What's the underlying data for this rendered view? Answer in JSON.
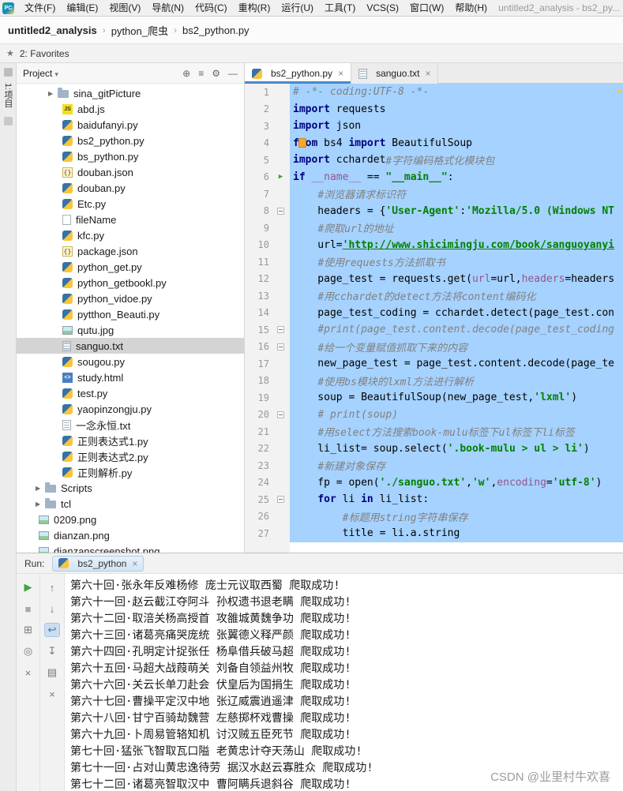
{
  "colors": {
    "selection": "#A6D2FF",
    "keyword": "#000080",
    "string": "#008000",
    "comment": "#808080",
    "param": "#94558D",
    "tab_accent": "#4A88C7",
    "run_green": "#3FA342"
  },
  "title_bar": {
    "logo": "PC",
    "menus": [
      "文件(F)",
      "编辑(E)",
      "视图(V)",
      "导航(N)",
      "代码(C)",
      "重构(R)",
      "运行(U)",
      "工具(T)",
      "VCS(S)",
      "窗口(W)",
      "帮助(H)"
    ],
    "window_title": "untitled2_analysis - bs2_py..."
  },
  "breadcrumb": [
    "untitled2_analysis",
    "python_爬虫",
    "bs2_python.py"
  ],
  "favorites": {
    "label": "2: Favorites"
  },
  "tool_strip": {
    "label": "1:项目"
  },
  "project": {
    "title": "Project",
    "header_icons": [
      {
        "name": "locate-icon",
        "glyph": "⊕"
      },
      {
        "name": "collapse-all-icon",
        "glyph": "≡"
      },
      {
        "name": "settings-icon",
        "glyph": "⚙"
      },
      {
        "name": "hide-panel-icon",
        "glyph": "—"
      }
    ],
    "items": [
      {
        "label": "sina_gitPicture",
        "icon": "folder",
        "indent": 40,
        "arrow": true
      },
      {
        "label": "abd.js",
        "icon": "js",
        "indent": 58
      },
      {
        "label": "baidufanyi.py",
        "icon": "python",
        "indent": 58
      },
      {
        "label": "bs2_python.py",
        "icon": "python",
        "indent": 58
      },
      {
        "label": "bs_python.py",
        "icon": "python",
        "indent": 58
      },
      {
        "label": "douban.json",
        "icon": "json",
        "indent": 58
      },
      {
        "label": "douban.py",
        "icon": "python",
        "indent": 58
      },
      {
        "label": "Etc.py",
        "icon": "python",
        "indent": 58
      },
      {
        "label": "fileName",
        "icon": "file",
        "indent": 58
      },
      {
        "label": "kfc.py",
        "icon": "python",
        "indent": 58
      },
      {
        "label": "package.json",
        "icon": "json",
        "indent": 58
      },
      {
        "label": "python_get.py",
        "icon": "python",
        "indent": 58
      },
      {
        "label": "python_getbookl.py",
        "icon": "python",
        "indent": 58
      },
      {
        "label": "python_vidoe.py",
        "icon": "python",
        "indent": 58
      },
      {
        "label": "pytthon_Beauti.py",
        "icon": "python",
        "indent": 58
      },
      {
        "label": "qutu.jpg",
        "icon": "image",
        "indent": 58
      },
      {
        "label": "sanguo.txt",
        "icon": "text",
        "indent": 58,
        "selected": true
      },
      {
        "label": "sougou.py",
        "icon": "python",
        "indent": 58
      },
      {
        "label": "study.html",
        "icon": "html",
        "indent": 58
      },
      {
        "label": "test.py",
        "icon": "python",
        "indent": 58
      },
      {
        "label": "yaopinzongju.py",
        "icon": "python",
        "indent": 58
      },
      {
        "label": "一念永恒.txt",
        "icon": "text",
        "indent": 58
      },
      {
        "label": "正则表达式1.py",
        "icon": "python",
        "indent": 58
      },
      {
        "label": "正则表达式2.py",
        "icon": "python",
        "indent": 58
      },
      {
        "label": "正则解析.py",
        "icon": "python",
        "indent": 58
      },
      {
        "label": "Scripts",
        "icon": "folder",
        "indent": 24,
        "arrow": true
      },
      {
        "label": "tcl",
        "icon": "folder",
        "indent": 24,
        "arrow": true
      },
      {
        "label": "0209.png",
        "icon": "image",
        "indent": 28
      },
      {
        "label": "dianzan.png",
        "icon": "image",
        "indent": 28
      },
      {
        "label": "dianzanscreenshot.png",
        "icon": "image",
        "indent": 28
      }
    ]
  },
  "editor": {
    "tabs": [
      {
        "label": "bs2_python.py",
        "icon": "python",
        "active": true
      },
      {
        "label": "sanguo.txt",
        "icon": "text",
        "active": false
      }
    ],
    "lines": [
      {
        "n": 1,
        "seg": [
          [
            "c",
            "# -*- coding:UTF-8 -*-"
          ]
        ]
      },
      {
        "n": 2,
        "seg": [
          [
            "k",
            "import"
          ],
          [
            "t",
            " requests"
          ]
        ]
      },
      {
        "n": 3,
        "seg": [
          [
            "k",
            "import"
          ],
          [
            "t",
            " json"
          ]
        ]
      },
      {
        "n": 4,
        "bulb": true,
        "seg": [
          [
            "k",
            "from"
          ],
          [
            "t",
            " bs4 "
          ],
          [
            "k",
            "import"
          ],
          [
            "t",
            " BeautifulSoup"
          ]
        ]
      },
      {
        "n": 5,
        "seg": [
          [
            "k",
            "import"
          ],
          [
            "t",
            " cchardet"
          ],
          [
            "c",
            "#字符编码格式化模块包"
          ]
        ]
      },
      {
        "n": 6,
        "mark": "run",
        "seg": [
          [
            "k",
            "if"
          ],
          [
            "t",
            " "
          ],
          [
            "d",
            "__name__"
          ],
          [
            "t",
            " == "
          ],
          [
            "s",
            "\"__main__\""
          ],
          [
            "t",
            ":"
          ]
        ]
      },
      {
        "n": 7,
        "seg": [
          [
            "t",
            "    "
          ],
          [
            "c",
            "#浏览器请求标识符"
          ]
        ]
      },
      {
        "n": 8,
        "mark": "fold",
        "seg": [
          [
            "t",
            "    headers = {"
          ],
          [
            "s",
            "'User-Agent'"
          ],
          [
            "t",
            ":"
          ],
          [
            "s",
            "'Mozilla/5.0 (Windows NT"
          ]
        ]
      },
      {
        "n": 9,
        "seg": [
          [
            "t",
            "    "
          ],
          [
            "c",
            "#爬取url的地址"
          ]
        ]
      },
      {
        "n": 10,
        "seg": [
          [
            "t",
            "    url="
          ],
          [
            "u",
            "'http://www.shicimingju.com/book/sanguoyanyi"
          ]
        ]
      },
      {
        "n": 11,
        "seg": [
          [
            "t",
            "    "
          ],
          [
            "c",
            "#使用requests方法抓取书"
          ]
        ]
      },
      {
        "n": 12,
        "seg": [
          [
            "t",
            "    page_test = requests.get("
          ],
          [
            "p",
            "url"
          ],
          [
            "t",
            "=url,"
          ],
          [
            "p",
            "headers"
          ],
          [
            "t",
            "=headers"
          ]
        ]
      },
      {
        "n": 13,
        "seg": [
          [
            "t",
            "    "
          ],
          [
            "c",
            "#用cchardet的detect方法将content编码化"
          ]
        ]
      },
      {
        "n": 14,
        "seg": [
          [
            "t",
            "    page_test_coding = cchardet.detect(page_test.con"
          ]
        ]
      },
      {
        "n": 15,
        "mark": "fold",
        "seg": [
          [
            "t",
            "    "
          ],
          [
            "c",
            "#print(page_test.content.decode(page_test_coding"
          ]
        ]
      },
      {
        "n": 16,
        "mark": "fold",
        "seg": [
          [
            "t",
            "    "
          ],
          [
            "c",
            "#给一个变量赋值抓取下来的内容"
          ]
        ]
      },
      {
        "n": 17,
        "seg": [
          [
            "t",
            "    new_page_test = page_test.content.decode(page_te"
          ]
        ]
      },
      {
        "n": 18,
        "seg": [
          [
            "t",
            "    "
          ],
          [
            "c",
            "#使用bs模块的lxml方法进行解析"
          ]
        ]
      },
      {
        "n": 19,
        "seg": [
          [
            "t",
            "    soup = BeautifulSoup(new_page_test,"
          ],
          [
            "s",
            "'lxml'"
          ],
          [
            "t",
            ")"
          ]
        ]
      },
      {
        "n": 20,
        "mark": "fold",
        "seg": [
          [
            "t",
            "    "
          ],
          [
            "c",
            "# print(soup)"
          ]
        ]
      },
      {
        "n": 21,
        "seg": [
          [
            "t",
            "    "
          ],
          [
            "c",
            "#用select方法搜索book-mulu标签下ul标签下li标签"
          ]
        ]
      },
      {
        "n": 22,
        "seg": [
          [
            "t",
            "    li_list= soup.select("
          ],
          [
            "s",
            "'.book-mulu > ul > li'"
          ],
          [
            "t",
            ")"
          ]
        ]
      },
      {
        "n": 23,
        "seg": [
          [
            "t",
            "    "
          ],
          [
            "c",
            "#新建对象保存"
          ]
        ]
      },
      {
        "n": 24,
        "seg": [
          [
            "t",
            "    fp = open("
          ],
          [
            "s",
            "'./sanguo.txt'"
          ],
          [
            "t",
            ","
          ],
          [
            "s",
            "'w'"
          ],
          [
            "t",
            ","
          ],
          [
            "p",
            "encoding"
          ],
          [
            "t",
            "="
          ],
          [
            "s",
            "'utf-8'"
          ],
          [
            "t",
            ")"
          ]
        ]
      },
      {
        "n": 25,
        "mark": "fold",
        "seg": [
          [
            "t",
            "    "
          ],
          [
            "k",
            "for"
          ],
          [
            "t",
            " li "
          ],
          [
            "k",
            "in"
          ],
          [
            "t",
            " li_list:"
          ]
        ]
      },
      {
        "n": 26,
        "seg": [
          [
            "t",
            "        "
          ],
          [
            "c",
            "#标题用string字符串保存"
          ]
        ]
      },
      {
        "n": 27,
        "seg": [
          [
            "t",
            "        title = li.a.string"
          ]
        ]
      }
    ]
  },
  "run": {
    "label": "Run:",
    "tab": {
      "label": "bs2_python",
      "icon": "python"
    },
    "toolbar_main": [
      {
        "name": "rerun-icon",
        "glyph": "▶",
        "color": "#3FA342"
      },
      {
        "name": "stop-icon",
        "glyph": "■",
        "color": "#A9A9A9"
      },
      {
        "name": "restore-layout-icon",
        "glyph": "⊞",
        "color": "#777777"
      },
      {
        "name": "pin-icon",
        "glyph": "◎",
        "color": "#777777"
      },
      {
        "name": "close-icon",
        "glyph": "×",
        "color": "#777777"
      }
    ],
    "toolbar_console": [
      {
        "name": "prev-occurrence-icon",
        "glyph": "↑",
        "color": "#777777"
      },
      {
        "name": "next-occurrence-icon",
        "glyph": "↓",
        "color": "#777777"
      },
      {
        "name": "soft-wrap-icon",
        "glyph": "↩",
        "color": "#4A78A0",
        "pressed": true
      },
      {
        "name": "scroll-to-end-icon",
        "glyph": "↧",
        "color": "#777777"
      },
      {
        "name": "print-icon",
        "glyph": "▤",
        "color": "#777777"
      },
      {
        "name": "clear-console-icon",
        "glyph": "×",
        "color": "#777777"
      }
    ],
    "output": [
      "第六十回·张永年反难杨修 庞士元议取西蜀 爬取成功!",
      "第六十一回·赵云截江夺阿斗 孙权遗书退老瞒 爬取成功!",
      "第六十二回·取涪关杨高授首 攻雒城黄魏争功 爬取成功!",
      "第六十三回·诸葛亮痛哭庞统 张翼德义释严颜 爬取成功!",
      "第六十四回·孔明定计捉张任 杨阜借兵破马超 爬取成功!",
      "第六十五回·马超大战葭萌关 刘备自领益州牧 爬取成功!",
      "第六十六回·关云长单刀赴会 伏皇后为国捐生 爬取成功!",
      "第六十七回·曹操平定汉中地 张辽威震逍遥津 爬取成功!",
      "第六十八回·甘宁百骑劫魏营 左慈掷杯戏曹操 爬取成功!",
      "第六十九回·卜周易管辂知机 讨汉贼五臣死节 爬取成功!",
      "第七十回·猛张飞智取瓦口隘 老黄忠计夺天荡山 爬取成功!",
      "第七十一回·占对山黄忠逸待劳 据汉水赵云寡胜众 爬取成功!",
      "第七十二回·诸葛亮智取汉中 曹阿瞒兵退斜谷 爬取成功!"
    ]
  },
  "watermark": "CSDN @业里村牛欢喜"
}
